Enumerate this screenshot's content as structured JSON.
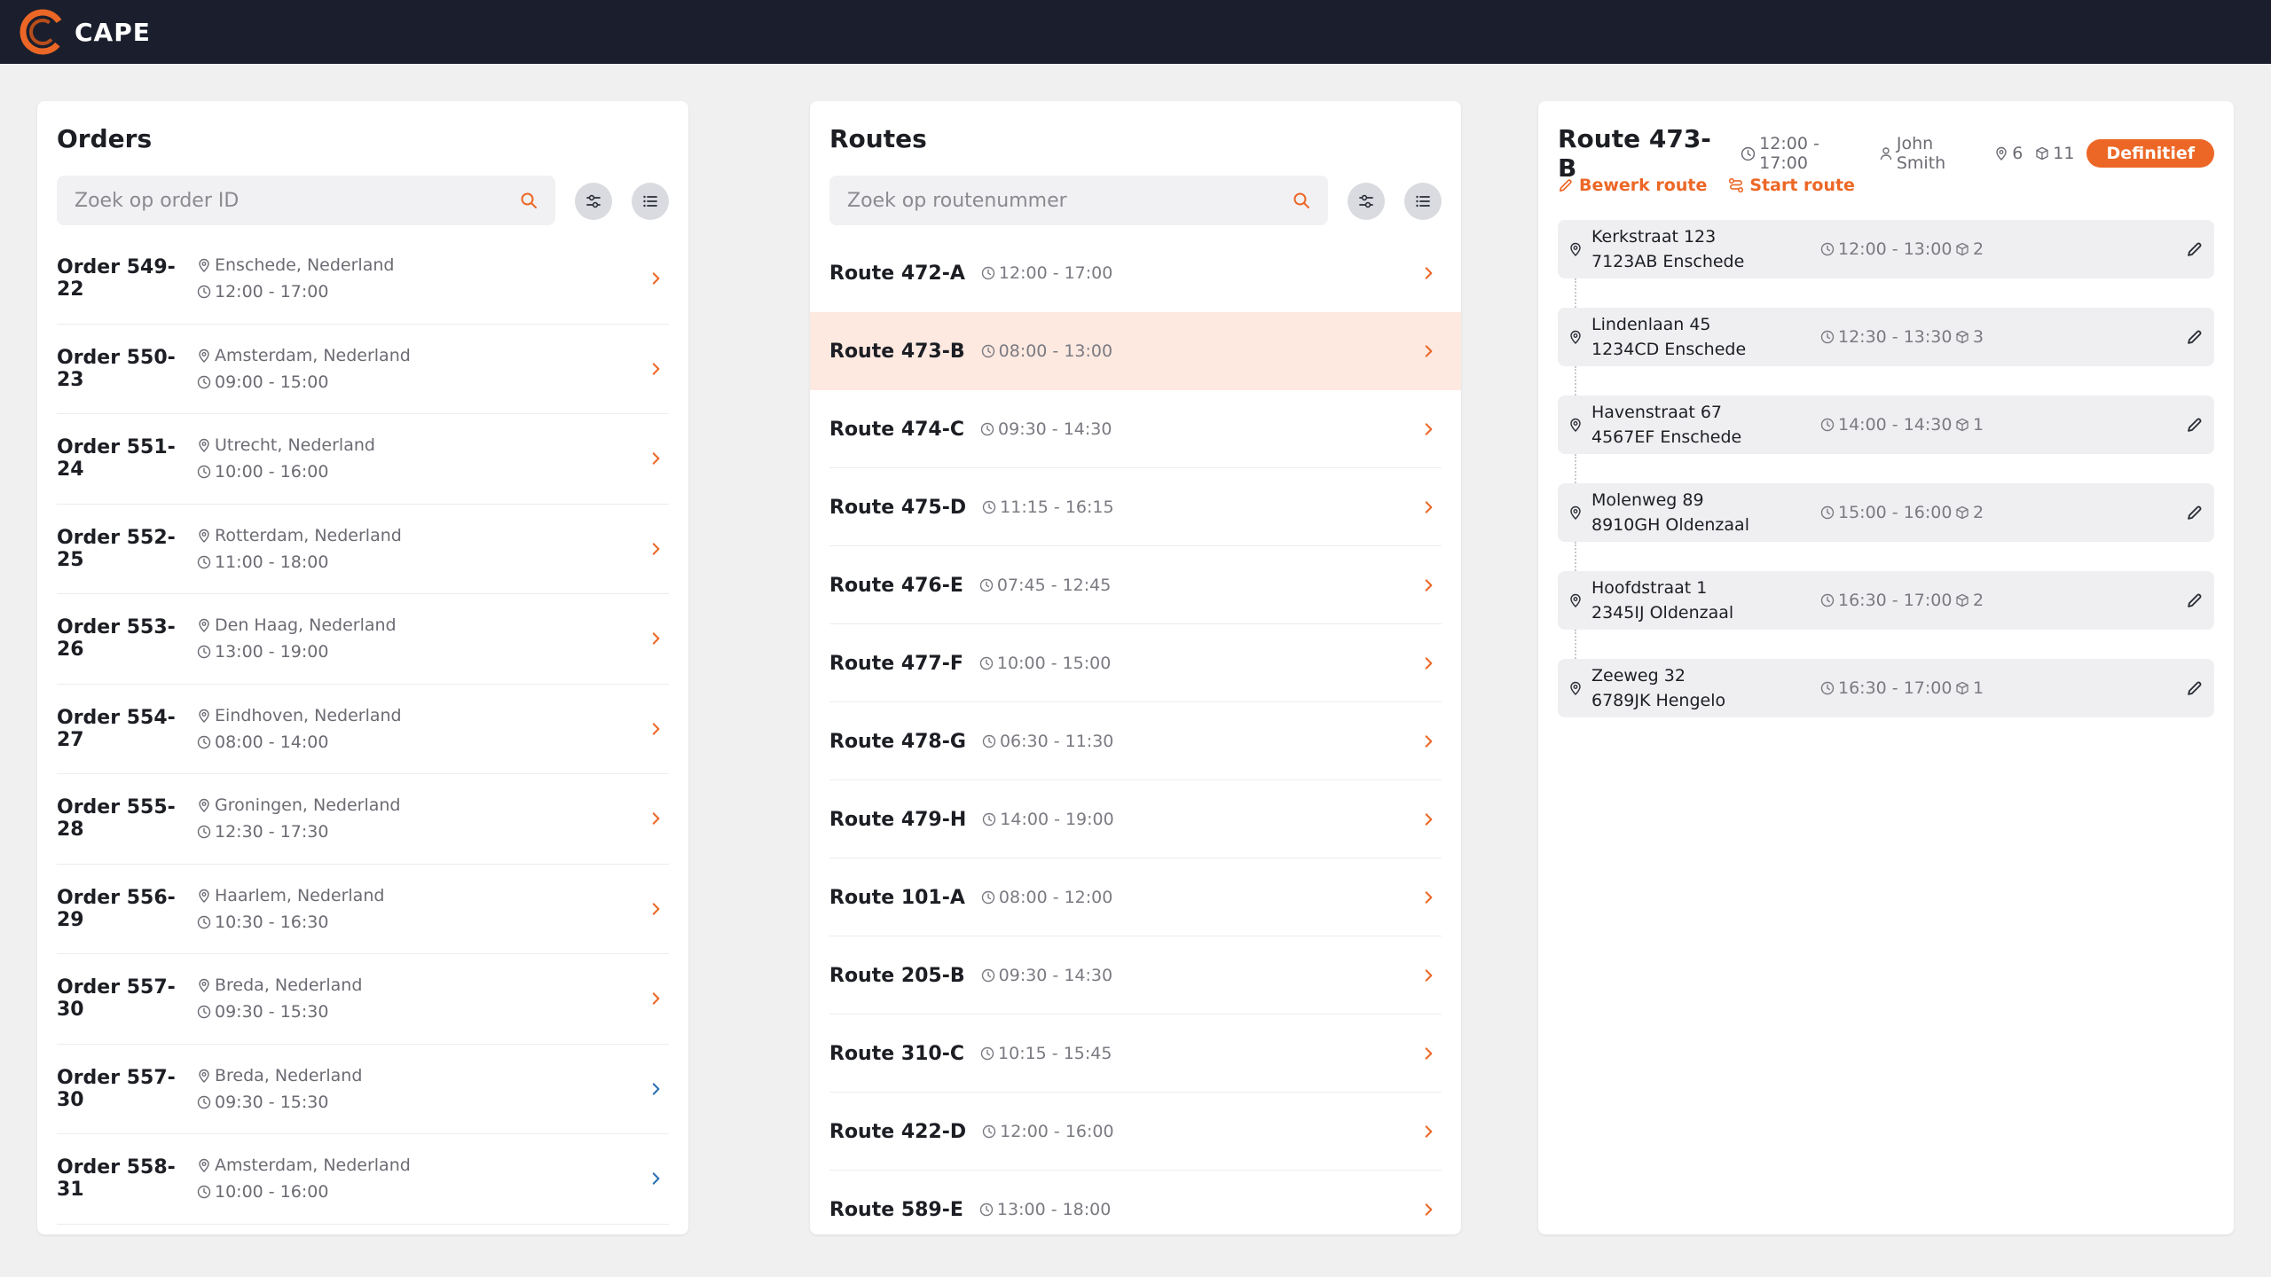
{
  "app": {
    "name": "CAPE",
    "accent": "#ec6726",
    "topbar_color": "#1b1f2d"
  },
  "orders": {
    "title": "Orders",
    "search_placeholder": "Zoek op order ID",
    "items": [
      {
        "id": "Order 549-22",
        "location": "Enschede, Nederland",
        "time": "12:00 - 17:00",
        "chevron_color": "#ec6726"
      },
      {
        "id": "Order 550-23",
        "location": "Amsterdam, Nederland",
        "time": "09:00 - 15:00",
        "chevron_color": "#ec6726"
      },
      {
        "id": "Order 551-24",
        "location": "Utrecht, Nederland",
        "time": "10:00 - 16:00",
        "chevron_color": "#ec6726"
      },
      {
        "id": "Order 552-25",
        "location": "Rotterdam, Nederland",
        "time": "11:00 - 18:00",
        "chevron_color": "#ec6726"
      },
      {
        "id": "Order 553-26",
        "location": "Den Haag, Nederland",
        "time": "13:00 - 19:00",
        "chevron_color": "#ec6726"
      },
      {
        "id": "Order 554-27",
        "location": "Eindhoven, Nederland",
        "time": "08:00 - 14:00",
        "chevron_color": "#ec6726"
      },
      {
        "id": "Order 555-28",
        "location": "Groningen, Nederland",
        "time": "12:30 - 17:30",
        "chevron_color": "#ec6726"
      },
      {
        "id": "Order 556-29",
        "location": "Haarlem, Nederland",
        "time": "10:30 - 16:30",
        "chevron_color": "#ec6726"
      },
      {
        "id": "Order 557-30",
        "location": "Breda, Nederland",
        "time": "09:30 - 15:30",
        "chevron_color": "#ec6726"
      },
      {
        "id": "Order 557-30",
        "location": "Breda, Nederland",
        "time": "09:30 - 15:30",
        "chevron_color": "#2a6fb0"
      },
      {
        "id": "Order 558-31",
        "location": "Amsterdam, Nederland",
        "time": "10:00 - 16:00",
        "chevron_color": "#2a6fb0"
      }
    ]
  },
  "routes": {
    "title": "Routes",
    "search_placeholder": "Zoek op routenummer",
    "items": [
      {
        "name": "Route 472-A",
        "time": "12:00 - 17:00",
        "selected": false
      },
      {
        "name": "Route 473-B",
        "time": "08:00 - 13:00",
        "selected": true
      },
      {
        "name": "Route 474-C",
        "time": "09:30 - 14:30",
        "selected": false
      },
      {
        "name": "Route 475-D",
        "time": "11:15 - 16:15",
        "selected": false
      },
      {
        "name": "Route 476-E",
        "time": "07:45 - 12:45",
        "selected": false
      },
      {
        "name": "Route 477-F",
        "time": "10:00 - 15:00",
        "selected": false
      },
      {
        "name": "Route 478-G",
        "time": "06:30 - 11:30",
        "selected": false
      },
      {
        "name": "Route 479-H",
        "time": "14:00 - 19:00",
        "selected": false
      },
      {
        "name": "Route 101-A",
        "time": "08:00 - 12:00",
        "selected": false
      },
      {
        "name": "Route 205-B",
        "time": "09:30 - 14:30",
        "selected": false
      },
      {
        "name": "Route 310-C",
        "time": "10:15 - 15:45",
        "selected": false
      },
      {
        "name": "Route 422-D",
        "time": "12:00 - 16:00",
        "selected": false
      },
      {
        "name": "Route 589-E",
        "time": "13:00 - 18:00",
        "selected": false
      }
    ]
  },
  "detail": {
    "title": "Route 473-B",
    "time": "12:00 - 17:00",
    "driver": "John Smith",
    "stop_count": "6",
    "package_count": "11",
    "status": "Definitief",
    "edit_label": "Bewerk route",
    "start_label": "Start route",
    "stops": [
      {
        "street": "Kerkstraat 123",
        "city": "7123AB Enschede",
        "time": "12:00 - 13:00",
        "qty": "2"
      },
      {
        "street": "Lindenlaan 45",
        "city": "1234CD Enschede",
        "time": "12:30 - 13:30",
        "qty": "3"
      },
      {
        "street": "Havenstraat 67",
        "city": "4567EF Enschede",
        "time": "14:00 - 14:30",
        "qty": "1"
      },
      {
        "street": "Molenweg 89",
        "city": "8910GH Oldenzaal",
        "time": "15:00 - 16:00",
        "qty": "2"
      },
      {
        "street": "Hoofdstraat 1",
        "city": "2345IJ Oldenzaal",
        "time": "16:30 - 17:00",
        "qty": "2"
      },
      {
        "street": "Zeeweg 32",
        "city": "6789JK Hengelo",
        "time": "16:30 - 17:00",
        "qty": "1"
      }
    ]
  }
}
